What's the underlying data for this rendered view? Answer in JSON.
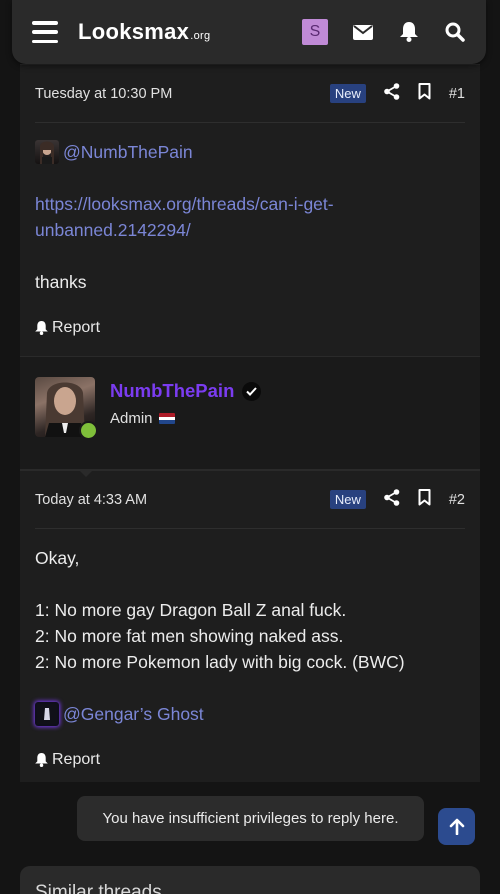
{
  "nav": {
    "logo_main": "Looksmax",
    "logo_suffix": ".org",
    "user_initial": "S"
  },
  "posts": [
    {
      "timestamp": "Tuesday at 10:30 PM",
      "badge": "New",
      "number": "#1",
      "mention": "@NumbThePain",
      "link": "https://looksmax.org/threads/can-i-get-unbanned.2142294/",
      "text": "thanks",
      "report_label": "Report"
    },
    {
      "author": {
        "name": "NumbThePain",
        "role": "Admin",
        "online": true
      },
      "timestamp": "Today at 4:33 AM",
      "badge": "New",
      "number": "#2",
      "lines": [
        "Okay,",
        "1: No more gay Dragon Ball Z anal fuck.",
        "2: No more fat men showing naked ass.",
        "2: No more Pokemon lady with big cock. (BWC)"
      ],
      "mention": "@Gengar’s Ghost",
      "report_label": "Report"
    }
  ],
  "footer": {
    "notice": "You have insufficient privileges to reply here."
  },
  "similar": {
    "heading": "Similar threads"
  },
  "colors": {
    "accent_link": "#7b86d6",
    "username": "#7b3cf0",
    "badge_new": "#28417f",
    "online": "#7fbf3a"
  }
}
